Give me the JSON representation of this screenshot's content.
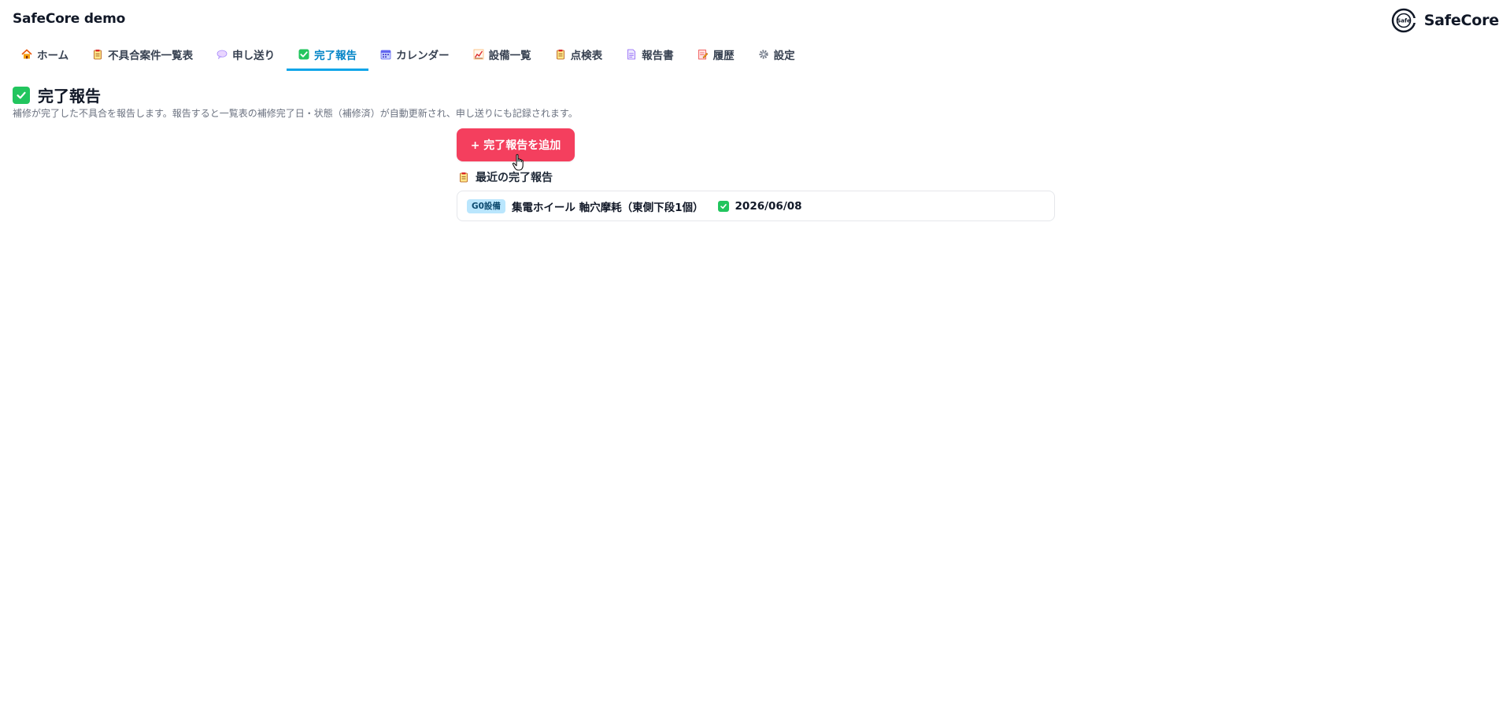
{
  "app": {
    "title": "SafeCore demo",
    "brand_name": "SafeCore",
    "logo_text": "Safe"
  },
  "nav": {
    "tabs": [
      {
        "label": "ホーム",
        "icon": "house-icon",
        "active": false
      },
      {
        "label": "不具合案件一覧表",
        "icon": "clipboard-icon",
        "active": false
      },
      {
        "label": "申し送り",
        "icon": "speech-bubble-icon",
        "active": false
      },
      {
        "label": "完了報告",
        "icon": "check-box-icon",
        "active": true
      },
      {
        "label": "カレンダー",
        "icon": "calendar-icon",
        "active": false
      },
      {
        "label": "設備一覧",
        "icon": "chart-icon",
        "active": false
      },
      {
        "label": "点検表",
        "icon": "clipboard-icon",
        "active": false
      },
      {
        "label": "報告書",
        "icon": "document-icon",
        "active": false
      },
      {
        "label": "履歴",
        "icon": "memo-icon",
        "active": false
      },
      {
        "label": "設定",
        "icon": "gear-icon",
        "active": false
      }
    ]
  },
  "page": {
    "title": "完了報告",
    "description": "補修が完了した不具合を報告します。報告すると一覧表の補修完了日・状態（補修済）が自動更新され、申し送りにも記録されます。"
  },
  "actions": {
    "add_label": "+ 完了報告を追加"
  },
  "recent": {
    "title": "最近の完了報告",
    "items": [
      {
        "tag": "G0設備",
        "title": "集電ホイール 軸穴摩耗（東側下段1個）",
        "date": "2026/06/08"
      }
    ]
  },
  "colors": {
    "accent": "#0ea5e9",
    "primary_button": "#f43f5e",
    "success": "#22c55e",
    "tag_bg": "#bae6fd"
  }
}
